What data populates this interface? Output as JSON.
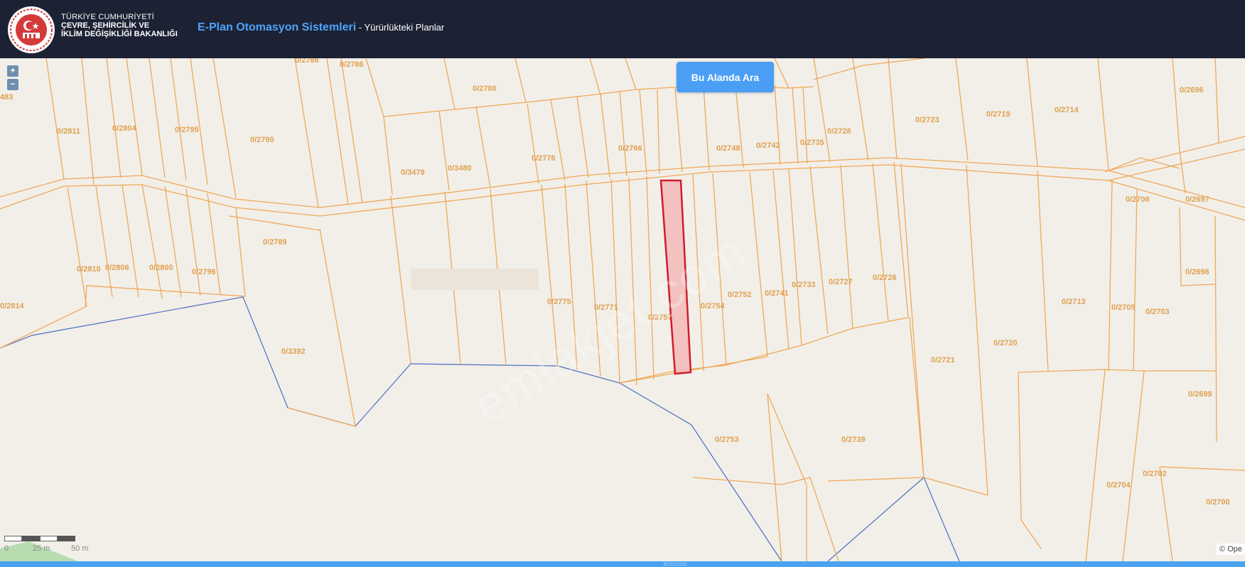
{
  "header": {
    "ministry_line1": "TÜRKİYE CUMHURİYETİ",
    "ministry_line2": "ÇEVRE, ŞEHİRCİLİK VE",
    "ministry_line3": "İKLİM DEĞİŞİKLİĞİ BAKANLIĞI",
    "app_title": "E-Plan Otomasyon Sistemleri",
    "app_subtitle": " - Yürürlükteki Planlar"
  },
  "map": {
    "search_button": "Bu Alanda Ara",
    "zoom_in": "+",
    "zoom_out": "−",
    "scale_labels": [
      "0",
      "25 m",
      "50 m"
    ],
    "attribution": "© Ope",
    "watermark": "emlakjet.com",
    "parcel_labels": [
      "483",
      "0/2788",
      "0/2786",
      "0/2780",
      "0/2811",
      "0/2804",
      "0/2795",
      "0/2790",
      "0/3479",
      "0/3480",
      "0/2776",
      "0/2766",
      "0/2748",
      "0/2742",
      "0/2735",
      "0/2728",
      "0/2723",
      "0/2719",
      "0/2714",
      "0/2696",
      "0/2706",
      "0/2697",
      "0/2789",
      "0/2810",
      "0/2806",
      "0/2800",
      "0/2796",
      "0/2814",
      "0/3392",
      "0/2775",
      "0/2771",
      "0/2757",
      "0/2754",
      "0/2752",
      "0/2741",
      "0/2733",
      "0/2727",
      "0/2726",
      "0/2713",
      "0/2705",
      "0/2703",
      "0/2698",
      "0/2721",
      "0/2720",
      "0/2699",
      "0/2753",
      "0/2739",
      "0/2704",
      "0/2702",
      "0/2700"
    ],
    "colors": {
      "parcel_line": "#f0a858",
      "label": "#e0a050",
      "highlight_fill": "#f3b8b8",
      "highlight_stroke": "#d01c2c",
      "water_line": "#4a6fc0"
    }
  }
}
